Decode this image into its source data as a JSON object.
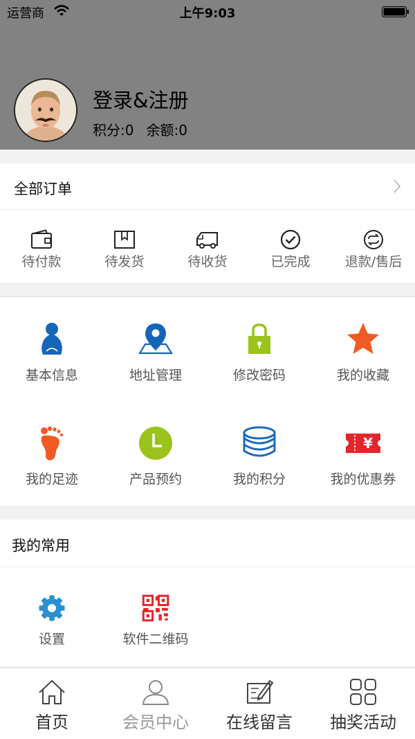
{
  "status_bar": {
    "carrier": "运营商",
    "time": "上午9:03"
  },
  "profile": {
    "login_label": "登录&注册",
    "points_label": "积分:0",
    "balance_label": "余额:0"
  },
  "orders": {
    "title": "全部订单",
    "statuses": [
      {
        "label": "待付款",
        "icon": "wallet-icon"
      },
      {
        "label": "待发货",
        "icon": "package-icon"
      },
      {
        "label": "待收货",
        "icon": "truck-icon"
      },
      {
        "label": "已完成",
        "icon": "check-circle-icon"
      },
      {
        "label": "退款/售后",
        "icon": "refund-icon"
      }
    ]
  },
  "menu": {
    "items": [
      {
        "label": "基本信息",
        "icon": "person-icon",
        "color": "#1565b8"
      },
      {
        "label": "地址管理",
        "icon": "location-pin-icon",
        "color": "#1565b8"
      },
      {
        "label": "修改密码",
        "icon": "lock-icon",
        "color": "#9ac31c"
      },
      {
        "label": "我的收藏",
        "icon": "star-icon",
        "color": "#f15a22"
      },
      {
        "label": "我的足迹",
        "icon": "footprint-icon",
        "color": "#f15a22"
      },
      {
        "label": "产品预约",
        "icon": "clock-icon",
        "color": "#9ac31c"
      },
      {
        "label": "我的积分",
        "icon": "coins-stack-icon",
        "color": "#1a6bbf"
      },
      {
        "label": "我的优惠券",
        "icon": "coupon-icon",
        "color": "#e4252b"
      }
    ]
  },
  "common": {
    "title": "我的常用",
    "items": [
      {
        "label": "设置",
        "icon": "gear-icon",
        "color": "#2a8fd0"
      },
      {
        "label": "软件二维码",
        "icon": "qrcode-icon",
        "color": "#e4252b"
      }
    ]
  },
  "tabbar": {
    "tabs": [
      {
        "label": "首页",
        "icon": "home-icon",
        "active": true
      },
      {
        "label": "会员中心",
        "icon": "member-icon",
        "active": false
      },
      {
        "label": "在线留言",
        "icon": "message-edit-icon",
        "active": true
      },
      {
        "label": "抽奖活动",
        "icon": "grid-apps-icon",
        "active": true
      }
    ]
  }
}
